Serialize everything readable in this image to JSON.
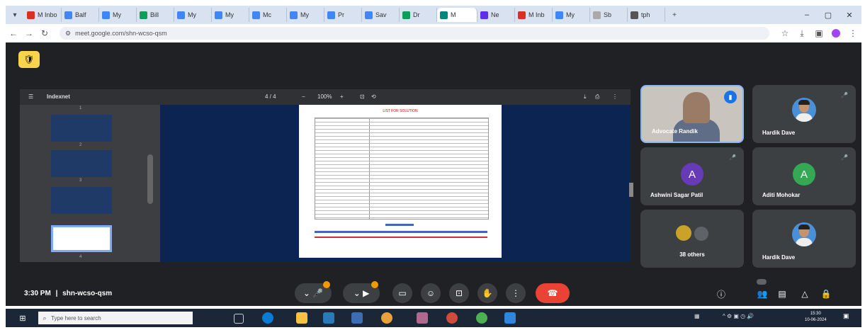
{
  "browser": {
    "tabs": [
      {
        "label": "M Inbo",
        "color": "#d93025"
      },
      {
        "label": "Balf",
        "color": "#4285f4"
      },
      {
        "label": "My",
        "color": "#4285f4"
      },
      {
        "label": "Bill",
        "color": "#0f9d58"
      },
      {
        "label": "My",
        "color": "#4285f4"
      },
      {
        "label": "My",
        "color": "#4285f4"
      },
      {
        "label": "Mc",
        "color": "#4285f4"
      },
      {
        "label": "My",
        "color": "#4285f4"
      },
      {
        "label": "Pr",
        "color": "#4285f4"
      },
      {
        "label": "Sav",
        "color": "#4285f4"
      },
      {
        "label": "Dr",
        "color": "#0f9d58"
      },
      {
        "label": "M",
        "color": "#00897b"
      },
      {
        "label": "Ne",
        "color": "#5f2eea"
      },
      {
        "label": "M Inb",
        "color": "#d93025"
      },
      {
        "label": "My",
        "color": "#4285f4"
      },
      {
        "label": "Sb",
        "color": "#aaaaaa"
      },
      {
        "label": "tph",
        "color": "#555555"
      }
    ],
    "url": "meet.google.com/shn-wcso-qsm"
  },
  "pdf": {
    "title": "Indexnet",
    "page_indicator": "4 / 4",
    "zoom": "100%",
    "page_heading": "LIST FOR SOLUTION",
    "thumbnail_pages": [
      "1",
      "2",
      "3",
      "4"
    ]
  },
  "participants": [
    {
      "name": "Advocate Randik",
      "type": "video"
    },
    {
      "name": "Hardik Dave",
      "type": "photo"
    },
    {
      "name": "Ashwini Sagar Patil",
      "type": "letter",
      "letter": "A",
      "color": "#673ab7"
    },
    {
      "name": "Aditi Mohokar",
      "type": "letter",
      "letter": "A",
      "color": "#34a853"
    },
    {
      "name": "38 others",
      "type": "others"
    },
    {
      "name": "Hardik Dave",
      "type": "photo"
    }
  ],
  "meeting": {
    "time": "3:30 PM",
    "separator": "|",
    "code": "shn-wcso-qsm"
  },
  "taskbar": {
    "search_placeholder": "Type here to search",
    "time": "15:30",
    "date": "10-06-2024"
  }
}
